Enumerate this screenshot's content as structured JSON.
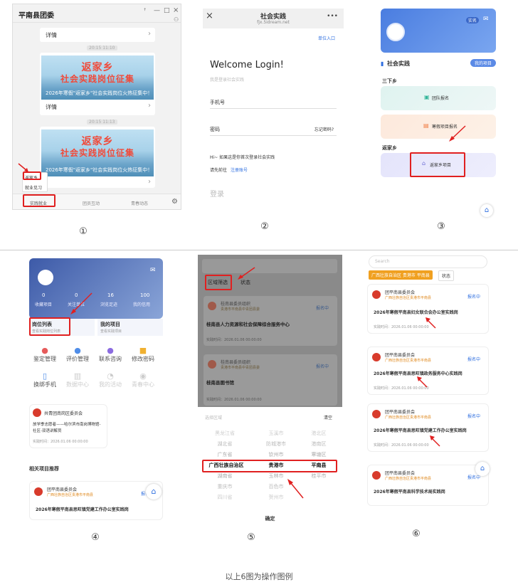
{
  "p1": {
    "window_title": "平南县团委",
    "titlebar_icons": [
      "ꜛ",
      "—",
      "□",
      "×"
    ],
    "detail_label": "详情",
    "time_1": "20:15 11:10",
    "time_2": "20:15 11:13",
    "banner_title": "返家乡",
    "banner_title2": "社会实践岗位征集",
    "banner_sub": "2026年寒假\"返家乡\"社会实践岗位火热征集中！",
    "popup_items": [
      "返家乡",
      "就业见习"
    ],
    "tabs": [
      "实践就业",
      "团员互动",
      "青春动态"
    ]
  },
  "p2": {
    "nav_title": "社会实践",
    "nav_sub": "fjx.5idream.net",
    "more_icon": "•••",
    "unit_entry": "单位入口",
    "welcome": "Welcome Login!",
    "welcome_sub": "我是登录社会实践",
    "phone_label": "手机号",
    "password_label": "密码",
    "forgot": "忘记密码?",
    "hint": "Hi~ 如果这是你首次登录社会实践",
    "go_prefix": "请先前往",
    "register": "注册账号",
    "login_button": "登录"
  },
  "p3": {
    "tag": "实名",
    "section_title": "社会实践",
    "section_btn": "我的项目",
    "sub1": "三下乡",
    "card1": "团队报名",
    "card2": "寒假项目报名",
    "sub2": "返家乡",
    "card3": "返家乡项目"
  },
  "p4": {
    "stats": [
      {
        "n": "0",
        "l": "收藏项目"
      },
      {
        "n": "0",
        "l": "关注单位"
      },
      {
        "n": "16",
        "l": "浏览足迹"
      },
      {
        "n": "100",
        "l": "我的信用"
      }
    ],
    "job_list": "岗位列表",
    "job_list_sub": "查看实践岗位列表",
    "my_project": "我的项目",
    "my_project_sub": "查看实践项目",
    "menu": [
      "鉴定管理",
      "评价管理",
      "联系咨询",
      "修改密码",
      "换绑手机",
      "数据中心",
      "我的活动",
      "青春中心"
    ],
    "org_name": "共青团南岗区委员会",
    "org_line": "放学季志愿者——哈尔滨市南岗博物馆-社区-双语讲解员",
    "org_time": "实践时间：2026.01.06 00:00:00",
    "rec_title": "相关项目推荐",
    "rec_org": "团平南县委员会",
    "rec_loc": "广西壮族自治区贵港市平南县",
    "rec_status": "报名中",
    "rec_project": "2026年寒假平南县思旺镇党建工作办公室实践岗"
  },
  "p5": {
    "filter_region": "区域筛选",
    "filter_status": "状态",
    "org1": "桂南县委员组织",
    "org1_loc": "贵港市平南县中青团县委",
    "status": "报名中",
    "project1": "桂南县人力资源和社会保障综合服务中心",
    "time1": "实践时间：2026.01.06 00:00:00",
    "org2": "桂南县委员组织",
    "org2_loc": "贵港市平南县中青团县委",
    "project2": "桂南县图书馆",
    "time2": "实践时间：2026.01.06 00:00:00",
    "sheet_title": "选择区域",
    "clear": "清空",
    "col1": [
      "黑龙江省",
      "湖北省",
      "广东省",
      "广西壮族自治区",
      "湖南省",
      "重庆市",
      "四川省"
    ],
    "col2": [
      "玉溪市",
      "防城港市",
      "钦州市",
      "贵港市",
      "玉林市",
      "百色市",
      "贺州市"
    ],
    "col3": [
      "港北区",
      "港南区",
      "覃塘区",
      "平南县",
      "桂平市"
    ],
    "confirm": "确定"
  },
  "p6": {
    "search_placeholder": "Search",
    "filter_chip": "广西壮族自治区 贵港市 平南县",
    "status_chip": "状态",
    "cards": [
      {
        "org": "团平南县委员会",
        "loc": "广西壮族自治区贵港市平南县",
        "status": "报名中",
        "project": "2026年寒假平南县妇女联合会办公室实践岗",
        "time": "实践时间：2026.01.06 00:00:00"
      },
      {
        "org": "团平南县委员会",
        "loc": "广西壮族自治区贵港市平南县",
        "status": "报名中",
        "project": "2026年寒假平南县思旺镇政务服务中心实践岗",
        "time": "实践时间：2026.01.06 00:00:00"
      },
      {
        "org": "团平南县委员会",
        "loc": "广西壮族自治区贵港市平南县",
        "status": "报名中",
        "project": "2026年寒假平南县思旺镇党建工作办公室实践岗",
        "time": "实践时间：2026.01.06 00:00:00"
      },
      {
        "org": "团平南县委员会",
        "loc": "广西壮族自治区贵港市平南县",
        "status": "报名中",
        "project": "2026年寒假平南县科学技术局实践岗",
        "time": ""
      }
    ]
  },
  "labels": [
    "①",
    "②",
    "③",
    "④",
    "⑤",
    "⑥"
  ],
  "caption": "以上6图为操作图例",
  "colors": {
    "red": "#e02020",
    "blue": "#2f6fe0",
    "orange": "#f0a020"
  }
}
